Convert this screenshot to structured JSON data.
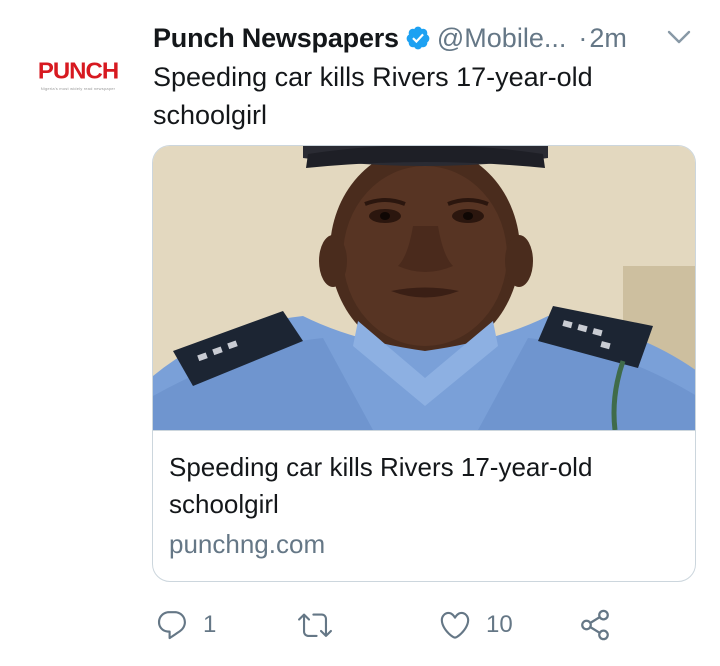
{
  "account": {
    "name": "Punch Newspapers",
    "handle": "@Mobile...",
    "separator": "·",
    "time": "2m",
    "avatar_logo": "PUNCH",
    "avatar_tagline": "Nigeria's most widely read newspaper"
  },
  "tweet": {
    "text": "Speeding car kills Rivers 17-year-old schoolgirl"
  },
  "card": {
    "title": "Speeding car kills Rivers 17-year-old schoolgirl",
    "domain": "punchng.com"
  },
  "actions": {
    "reply_count": "1",
    "retweet_count": "",
    "like_count": "10"
  },
  "icons": {
    "verified": "verified-badge-icon",
    "caret": "chevron-down-icon",
    "reply": "reply-icon",
    "retweet": "retweet-icon",
    "like": "heart-icon",
    "share": "share-icon"
  },
  "colors": {
    "brand_red": "#d71920",
    "verified_blue": "#1da1f2",
    "secondary_text": "#657786",
    "border": "#ccd6dd"
  }
}
